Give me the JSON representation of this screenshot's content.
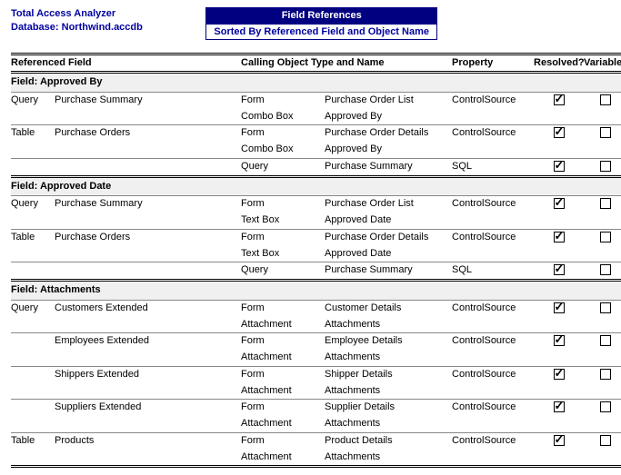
{
  "header": {
    "appName": "Total Access Analyzer",
    "dbLabel": "Database: Northwind.accdb",
    "title": "Field References",
    "subtitle": "Sorted By Referenced Field and Object Name"
  },
  "columns": {
    "refField": "Referenced Field",
    "calling": "Calling Object Type and Name",
    "property": "Property",
    "resolved": "Resolved?",
    "variable": "Variable?"
  },
  "groups": [
    {
      "title": "Field: Approved By",
      "rows": [
        {
          "kind": "Query",
          "ref": "Purchase Summary",
          "otype": "Form",
          "sub": "Combo Box",
          "name1": "Purchase Order List",
          "name2": "Approved By",
          "prop": "ControlSource",
          "resolved": true,
          "variable": false,
          "sep": true
        },
        {
          "kind": "Table",
          "ref": "Purchase Orders",
          "otype": "Form",
          "sub": "Combo Box",
          "name1": "Purchase Order Details",
          "name2": "Approved By",
          "prop": "ControlSource",
          "resolved": true,
          "variable": false,
          "sep": true
        },
        {
          "kind": "",
          "ref": "",
          "otype": "Query",
          "sub": "",
          "name1": "Purchase Summary",
          "name2": "",
          "prop": "SQL",
          "resolved": true,
          "variable": false,
          "sep": false
        }
      ]
    },
    {
      "title": "Field: Approved Date",
      "rows": [
        {
          "kind": "Query",
          "ref": "Purchase Summary",
          "otype": "Form",
          "sub": "Text Box",
          "name1": "Purchase Order List",
          "name2": "Approved Date",
          "prop": "ControlSource",
          "resolved": true,
          "variable": false,
          "sep": true
        },
        {
          "kind": "Table",
          "ref": "Purchase Orders",
          "otype": "Form",
          "sub": "Text Box",
          "name1": "Purchase Order Details",
          "name2": "Approved Date",
          "prop": "ControlSource",
          "resolved": true,
          "variable": false,
          "sep": true
        },
        {
          "kind": "",
          "ref": "",
          "otype": "Query",
          "sub": "",
          "name1": "Purchase Summary",
          "name2": "",
          "prop": "SQL",
          "resolved": true,
          "variable": false,
          "sep": false
        }
      ]
    },
    {
      "title": "Field: Attachments",
      "rows": [
        {
          "kind": "Query",
          "ref": "Customers Extended",
          "otype": "Form",
          "sub": "Attachment",
          "name1": "Customer Details",
          "name2": "Attachments",
          "prop": "ControlSource",
          "resolved": true,
          "variable": false,
          "sep": true
        },
        {
          "kind": "",
          "ref": "Employees Extended",
          "otype": "Form",
          "sub": "Attachment",
          "name1": "Employee Details",
          "name2": "Attachments",
          "prop": "ControlSource",
          "resolved": true,
          "variable": false,
          "sep": true
        },
        {
          "kind": "",
          "ref": "Shippers Extended",
          "otype": "Form",
          "sub": "Attachment",
          "name1": "Shipper Details",
          "name2": "Attachments",
          "prop": "ControlSource",
          "resolved": true,
          "variable": false,
          "sep": true
        },
        {
          "kind": "",
          "ref": "Suppliers Extended",
          "otype": "Form",
          "sub": "Attachment",
          "name1": "Supplier Details",
          "name2": "Attachments",
          "prop": "ControlSource",
          "resolved": true,
          "variable": false,
          "sep": true
        },
        {
          "kind": "Table",
          "ref": "Products",
          "otype": "Form",
          "sub": "Attachment",
          "name1": "Product Details",
          "name2": "Attachments",
          "prop": "ControlSource",
          "resolved": true,
          "variable": false,
          "sep": true,
          "last": true
        }
      ]
    }
  ]
}
